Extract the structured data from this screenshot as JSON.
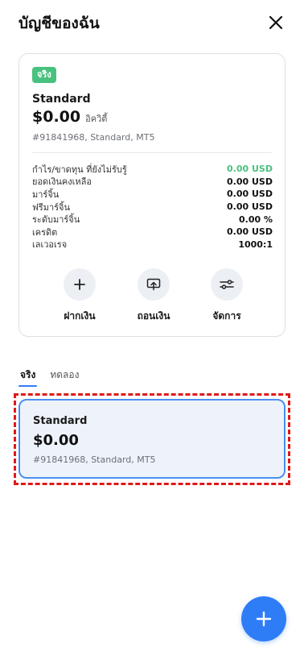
{
  "header": {
    "title": "บัญชีของฉัน",
    "close_icon": "close-icon"
  },
  "summary": {
    "badge": "จริง",
    "account_type": "Standard",
    "balance": "$0.00",
    "balance_suffix": "อิควิตี้",
    "meta": "#91841968, Standard, MT5",
    "stats": [
      {
        "label": "กำไร/ขาดทุน ที่ยังไม่รับรู้",
        "value": "0.00 USD",
        "color": "#48c27e"
      },
      {
        "label": "ยอดเงินคงเหลือ",
        "value": "0.00 USD"
      },
      {
        "label": "มาร์จิ้น",
        "value": "0.00 USD"
      },
      {
        "label": "ฟรีมาร์จิ้น",
        "value": "0.00 USD"
      },
      {
        "label": "ระดับมาร์จิ้น",
        "value": "0.00 %"
      },
      {
        "label": "เครดิต",
        "value": "0.00 USD"
      },
      {
        "label": "เลเวอเรจ",
        "value": "1000:1"
      }
    ],
    "actions": [
      {
        "label": "ฝากเงิน",
        "icon": "plus-icon"
      },
      {
        "label": "ถอนเงิน",
        "icon": "withdraw-icon"
      },
      {
        "label": "จัดการ",
        "icon": "sliders-icon"
      }
    ]
  },
  "tabs": [
    {
      "label": "จริง",
      "active": true
    },
    {
      "label": "ทดลอง",
      "active": false
    }
  ],
  "account_list": [
    {
      "name": "Standard",
      "balance": "$0.00",
      "meta": "#91841968, Standard, MT5"
    }
  ],
  "fab": {
    "icon": "plus-icon"
  },
  "colors": {
    "accent": "#2f7df6",
    "positive": "#48c27e",
    "highlight": "#e01919"
  }
}
